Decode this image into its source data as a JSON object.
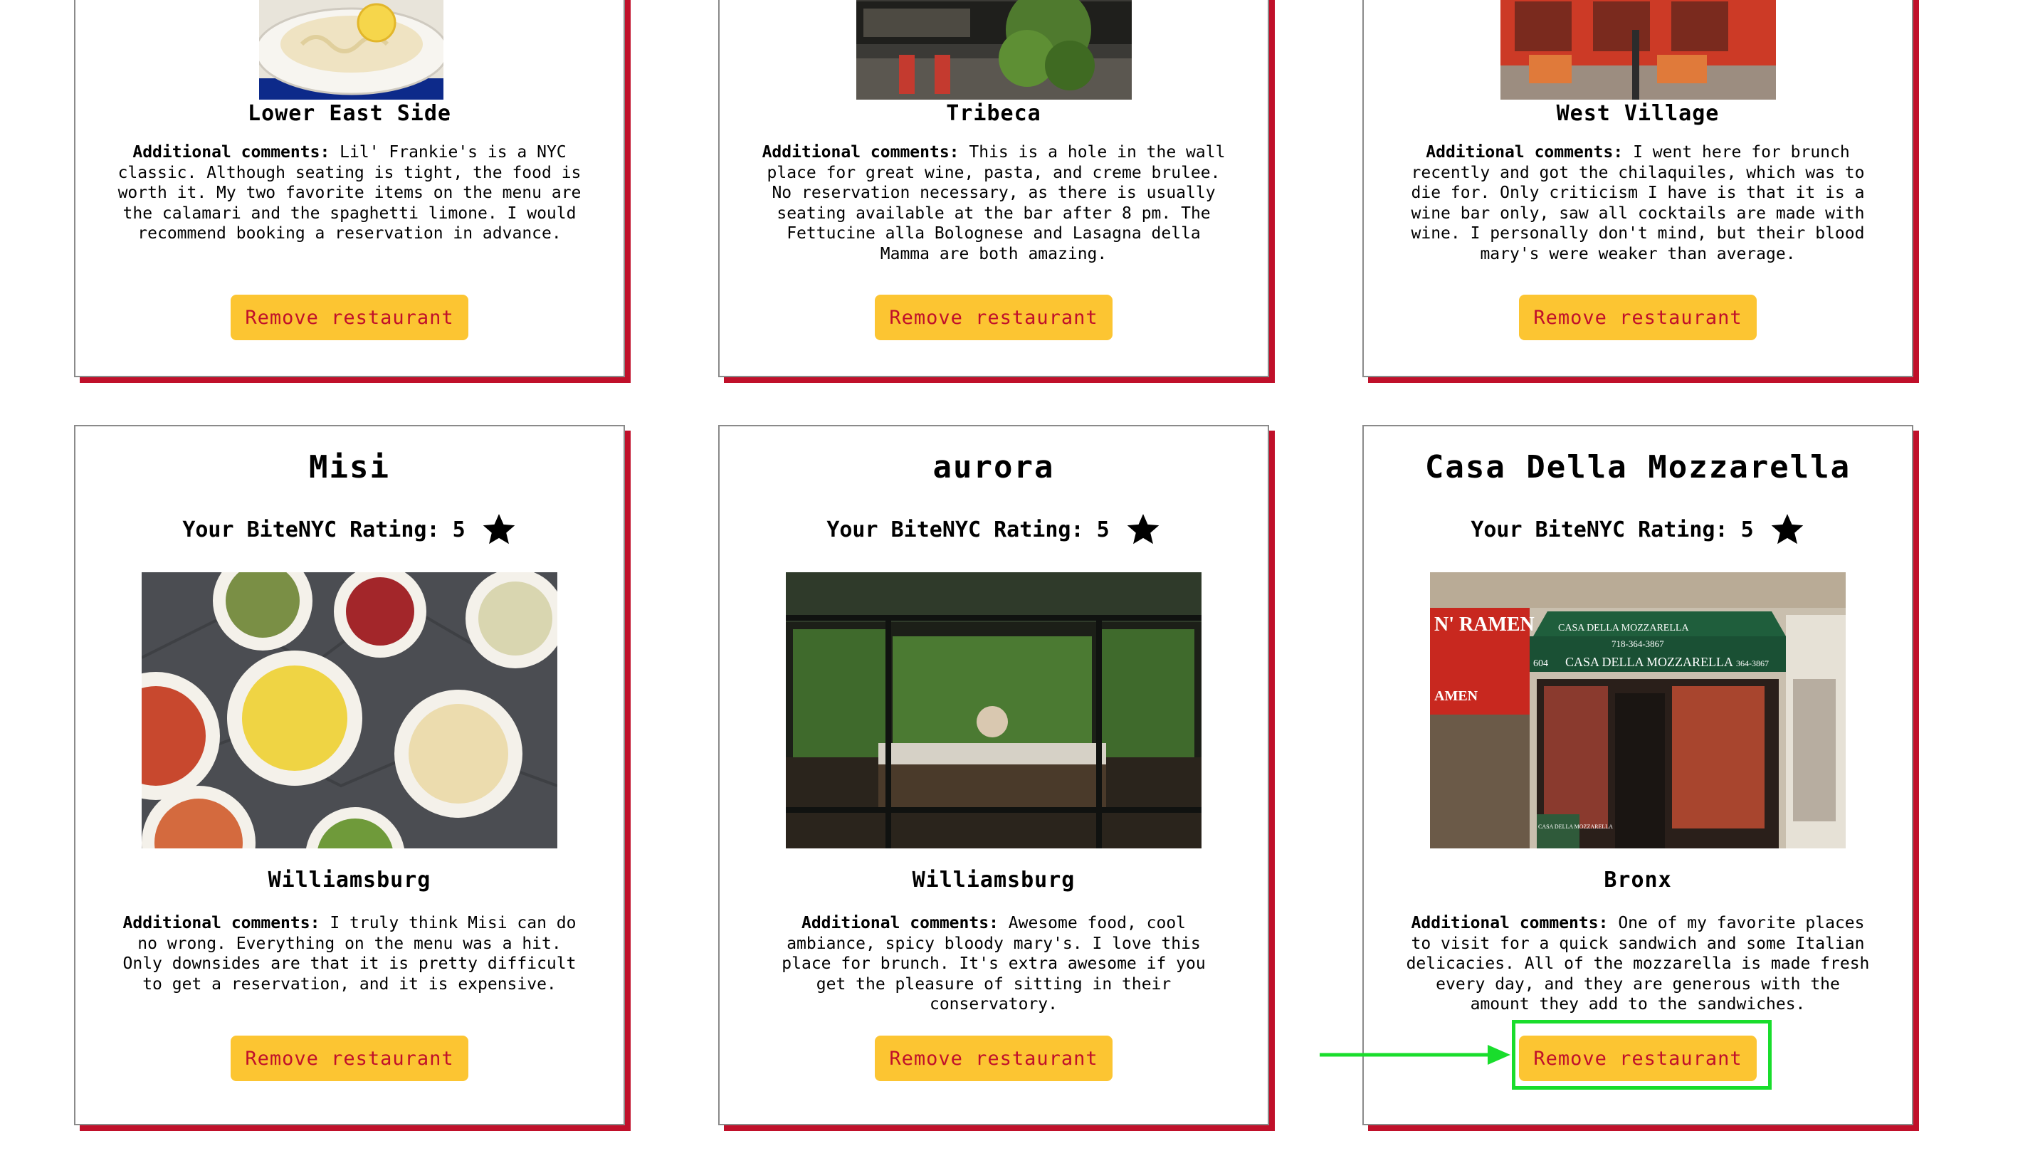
{
  "cards": [
    {
      "name": "",
      "neighborhood": "Lower East Side",
      "comments_label": "Additional comments:",
      "comments": "Lil' Frankie's is a NYC classic. Although seating is tight, the food is worth it. My two favorite items on the menu are the calamari and the spaghetti limone. I would recommend booking a reservation in advance.",
      "button_label": "Remove restaurant"
    },
    {
      "name": "",
      "neighborhood": "Tribeca",
      "comments_label": "Additional comments:",
      "comments": "This is a hole in the wall place for great wine, pasta, and creme brulee. No reservation necessary, as there is usually seating available at the bar after 8 pm. The Fettucine alla Bolognese and Lasagna della Mamma are both amazing.",
      "button_label": "Remove restaurant"
    },
    {
      "name": "",
      "neighborhood": "West Village",
      "comments_label": "Additional comments:",
      "comments": "I went here for brunch recently and got the chilaquiles, which was to die for. Only criticism I have is that it is a wine bar only, saw all cocktails are made with wine. I personally don't mind, but their blood mary's were weaker than average.",
      "button_label": "Remove restaurant"
    },
    {
      "name": "Misi",
      "rating_label": "Your BiteNYC Rating: 5",
      "neighborhood": "Williamsburg",
      "comments_label": "Additional comments:",
      "comments": "I truly think Misi can do no wrong. Everything on the menu was a hit. Only downsides are that it is pretty difficult to get a reservation, and it is expensive.",
      "button_label": "Remove restaurant"
    },
    {
      "name": "aurora",
      "rating_label": "Your BiteNYC Rating: 5",
      "neighborhood": "Williamsburg",
      "comments_label": "Additional comments:",
      "comments": "Awesome food, cool ambiance, spicy bloody mary's. I love this place for brunch. It's extra awesome if you get the pleasure of sitting in their conservatory.",
      "button_label": "Remove restaurant"
    },
    {
      "name": "Casa Della Mozzarella",
      "rating_label": "Your BiteNYC Rating: 5",
      "neighborhood": "Bronx",
      "comments_label": "Additional comments:",
      "comments": "One of my favorite places to visit for a quick sandwich and some Italian delicacies. All of the mozzarella is made fresh every day, and they are generous with the amount they add to the sandwiches.",
      "button_label": "Remove restaurant"
    }
  ],
  "photo_signage": {
    "ramen": "N' RAMEN",
    "ramen_side": "AMEN",
    "awning_top": "CASA DELLA MOZZARELLA",
    "awning_phone": "718-364-3867",
    "awning_number": "604",
    "awning_name": "CASA DELLA MOZZARELLA",
    "awning_phone_short": "364-3867",
    "window_sign": "CASA DELLA MOZZARELLA"
  },
  "colors": {
    "accent_shadow": "#c0102a",
    "button_bg": "#fcc532",
    "button_text": "#c0102a",
    "highlight": "#19dd2c"
  },
  "icons": [
    "star-icon",
    "arrow-icon"
  ]
}
